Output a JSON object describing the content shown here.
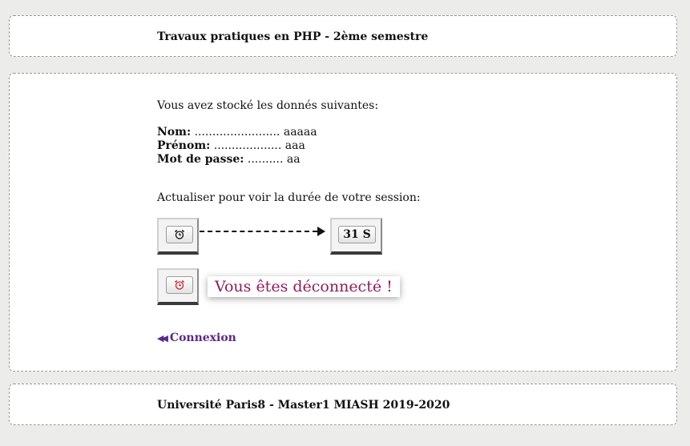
{
  "header": {
    "title": "Travaux pratiques en PHP - 2ème semestre"
  },
  "main": {
    "intro": "Vous avez stocké les donnés suivantes:",
    "fields": [
      {
        "label": "Nom:",
        "dots": " ........................ ",
        "value": "aaaaa"
      },
      {
        "label": "Prénom:",
        "dots": " ................... ",
        "value": "aaa"
      },
      {
        "label": "Mot de passe:",
        "dots": " .......... ",
        "value": "aa"
      }
    ],
    "refresh_text": "Actualiser pour voir la durée de votre session:",
    "timer_result": "31 S",
    "disconnected_message": "Vous êtes déconnecté !",
    "login_link": "Connexion",
    "icons": {
      "timer_start": "alarm-clock-icon",
      "timer_end": "alarm-clock-icon",
      "login": "double-arrow-left-icon"
    },
    "colors": {
      "alarm_start": "#111111",
      "alarm_end": "#d0202a",
      "disconnected": "#8a1f5b",
      "link": "#5b2a86"
    }
  },
  "footer": {
    "title": "Université Paris8 - Master1 MIASH 2019-2020"
  }
}
